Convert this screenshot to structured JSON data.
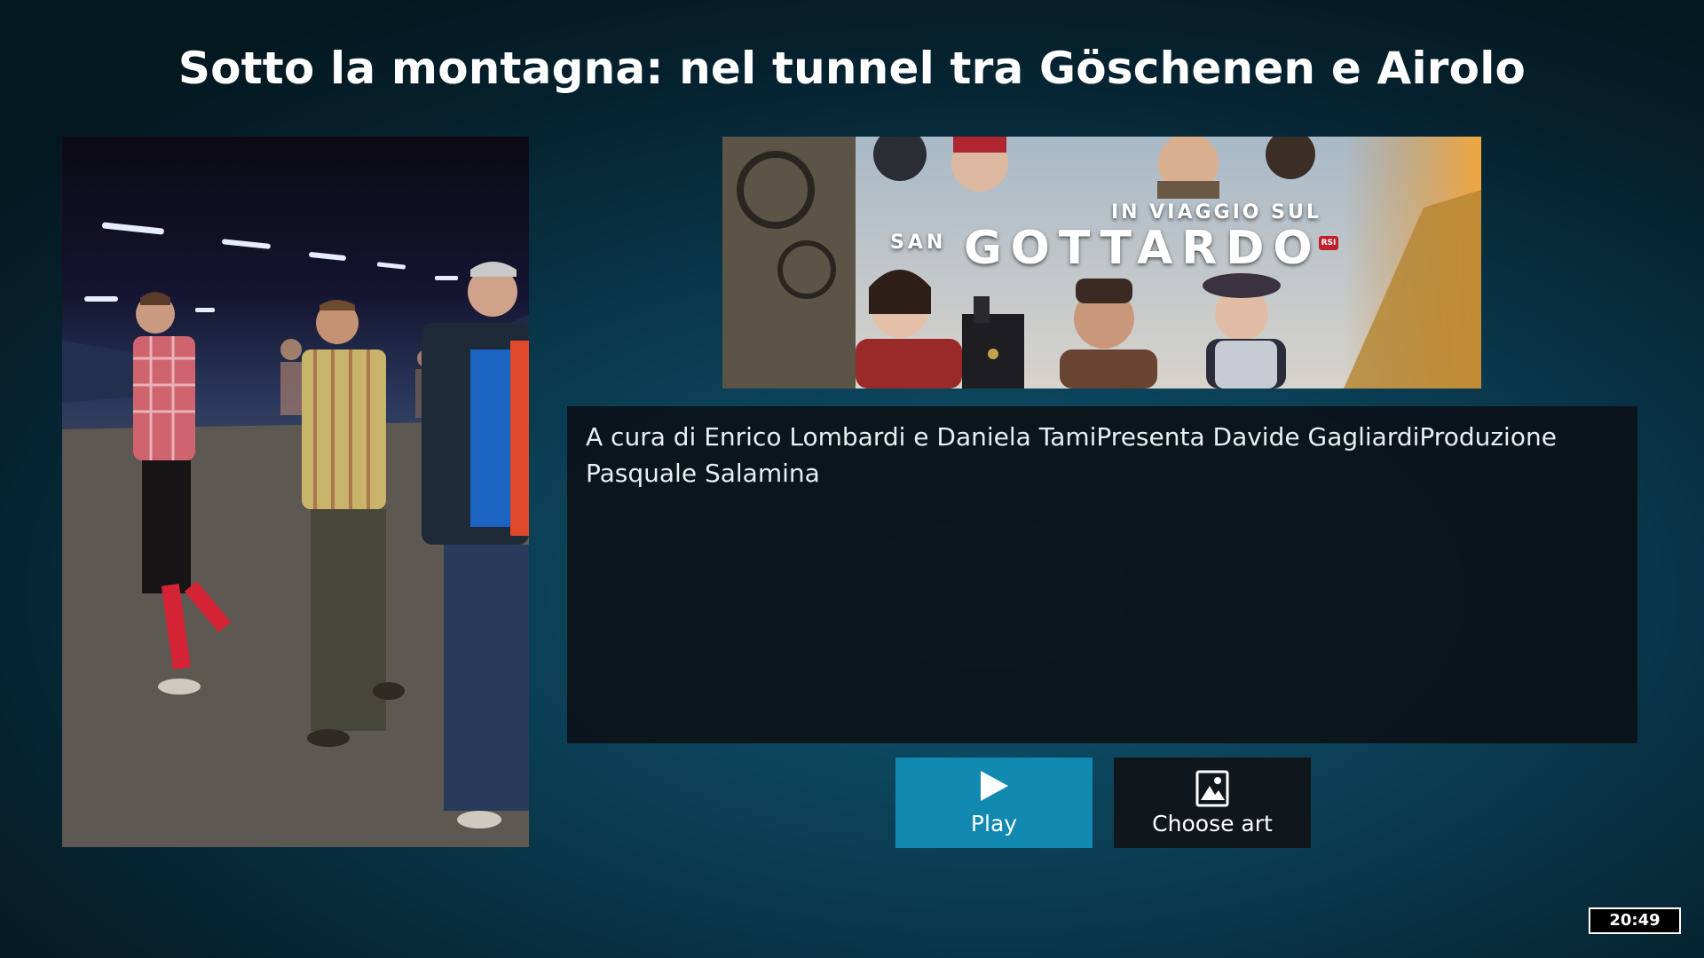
{
  "header": {
    "title": "Sotto la montagna: nel tunnel tra Göschenen e Airolo"
  },
  "fanart": {
    "subtitle": "IN VIAGGIO SUL",
    "prefix": "SAN",
    "title": "GOTTARDO",
    "badge": "RSI"
  },
  "plot": {
    "text": "A cura di Enrico Lombardi e Daniela TamiPresenta Davide GagliardiProduzione Pasquale Salamina"
  },
  "buttons": {
    "play": {
      "label": "Play",
      "icon": "play-icon"
    },
    "choose_art": {
      "label": "Choose art",
      "icon": "image-icon"
    }
  },
  "status": {
    "clock": "20:49"
  },
  "colors": {
    "accent": "#1189b0",
    "panel": "#0c1218",
    "background": "#0a3b50"
  }
}
